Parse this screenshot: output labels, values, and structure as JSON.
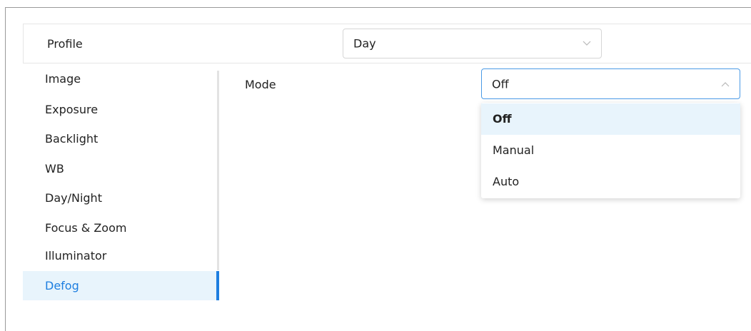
{
  "profile": {
    "label": "Profile",
    "selected": "Day"
  },
  "sidebar": {
    "items": [
      {
        "label": "Image"
      },
      {
        "label": "Exposure"
      },
      {
        "label": "Backlight"
      },
      {
        "label": "WB"
      },
      {
        "label": "Day/Night"
      },
      {
        "label": "Focus & Zoom"
      },
      {
        "label": "Illuminator"
      },
      {
        "label": "Defog"
      }
    ],
    "active": "Defog"
  },
  "mode": {
    "label": "Mode",
    "selected": "Off",
    "options": [
      "Off",
      "Manual",
      "Auto"
    ]
  },
  "icons": {
    "profile_select": "chevron-down-icon",
    "mode_select": "chevron-up-icon"
  },
  "colors": {
    "accent": "#1d7ee0",
    "highlight_bg": "#e8f4fc",
    "focus_border": "#4a9ae6"
  }
}
